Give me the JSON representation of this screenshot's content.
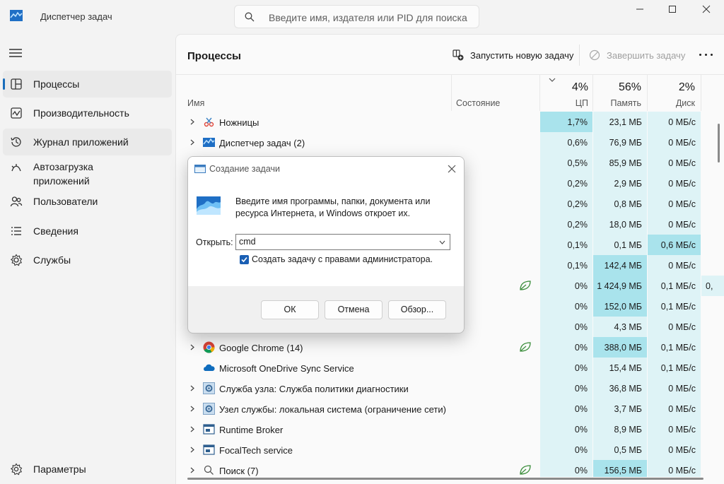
{
  "app": {
    "title": "Диспетчер задач",
    "search_placeholder": "Введите имя, издателя или PID для поиска"
  },
  "sidebar": {
    "items": [
      {
        "label": "Процессы",
        "icon": "processes-icon"
      },
      {
        "label": "Производительность",
        "icon": "performance-icon"
      },
      {
        "label": "Журнал приложений",
        "icon": "history-icon"
      },
      {
        "label": "Автозагрузка приложений",
        "icon": "startup-icon"
      },
      {
        "label": "Пользователи",
        "icon": "users-icon"
      },
      {
        "label": "Сведения",
        "icon": "details-icon"
      },
      {
        "label": "Службы",
        "icon": "services-icon"
      }
    ],
    "settings_label": "Параметры"
  },
  "toolbar": {
    "page_title": "Процессы",
    "run_task_label": "Запустить новую задачу",
    "end_task_label": "Завершить задачу"
  },
  "table": {
    "headers": {
      "name": "Имя",
      "status": "Состояние",
      "cpu": "ЦП",
      "memory": "Память",
      "disk": "Диск"
    },
    "totals": {
      "cpu": "4%",
      "memory": "56%",
      "disk": "2%"
    },
    "rows": [
      {
        "name": "Ножницы",
        "cpu": "1,7%",
        "mem": "23,1 МБ",
        "disk": "0 МБ/с",
        "net": ""
      },
      {
        "name": "Диспетчер задач (2)",
        "cpu": "0,6%",
        "mem": "76,9 МБ",
        "disk": "0 МБ/с",
        "net": ""
      },
      {
        "name": "",
        "cpu": "0,5%",
        "mem": "85,9 МБ",
        "disk": "0 МБ/с",
        "net": ""
      },
      {
        "name": "",
        "cpu": "0,2%",
        "mem": "2,9 МБ",
        "disk": "0 МБ/с",
        "net": ""
      },
      {
        "name": "",
        "cpu": "0,2%",
        "mem": "0,8 МБ",
        "disk": "0 МБ/с",
        "net": ""
      },
      {
        "name": "",
        "cpu": "0,2%",
        "mem": "18,0 МБ",
        "disk": "0 МБ/с",
        "net": ""
      },
      {
        "name": "",
        "cpu": "0,1%",
        "mem": "0,1 МБ",
        "disk": "0,6 МБ/с",
        "net": ""
      },
      {
        "name": "",
        "cpu": "0,1%",
        "mem": "142,4 МБ",
        "disk": "0 МБ/с",
        "net": ""
      },
      {
        "name": "",
        "cpu": "0%",
        "mem": "1 424,9 МБ",
        "disk": "0,1 МБ/с",
        "net": "0,"
      },
      {
        "name": "",
        "cpu": "0%",
        "mem": "152,0 МБ",
        "disk": "0,1 МБ/с",
        "net": ""
      },
      {
        "name": "",
        "cpu": "0%",
        "mem": "4,3 МБ",
        "disk": "0 МБ/с",
        "net": ""
      },
      {
        "name": "Google Chrome (14)",
        "cpu": "0%",
        "mem": "388,0 МБ",
        "disk": "0,1 МБ/с",
        "net": ""
      },
      {
        "name": "Microsoft OneDrive Sync Service",
        "cpu": "0%",
        "mem": "15,4 МБ",
        "disk": "0,1 МБ/с",
        "net": ""
      },
      {
        "name": "Служба узла: Служба политики диагностики",
        "cpu": "0%",
        "mem": "36,8 МБ",
        "disk": "0 МБ/с",
        "net": ""
      },
      {
        "name": "Узел службы: локальная система (ограничение сети)",
        "cpu": "0%",
        "mem": "3,7 МБ",
        "disk": "0 МБ/с",
        "net": ""
      },
      {
        "name": "Runtime Broker",
        "cpu": "0%",
        "mem": "8,9 МБ",
        "disk": "0 МБ/с",
        "net": ""
      },
      {
        "name": "FocalTech service",
        "cpu": "0%",
        "mem": "0,5 МБ",
        "disk": "0 МБ/с",
        "net": ""
      },
      {
        "name": "Поиск (7)",
        "cpu": "0%",
        "mem": "156,5 МБ",
        "disk": "0 МБ/с",
        "net": ""
      }
    ]
  },
  "dialog": {
    "title": "Создание задачи",
    "message": "Введите имя программы, папки, документа или ресурса Интернета, и Windows откроет их.",
    "open_label": "Открыть:",
    "open_value": "cmd",
    "admin_checkbox_label": "Создать задачу с правами администратора.",
    "admin_checked": true,
    "ok_label": "ОК",
    "cancel_label": "Отмена",
    "browse_label": "Обзор..."
  },
  "colors": {
    "accent": "#1a6dbb",
    "heat_low": "#def3f6",
    "heat_mid": "#c6ecf1",
    "heat_high": "#a9e3ec"
  }
}
